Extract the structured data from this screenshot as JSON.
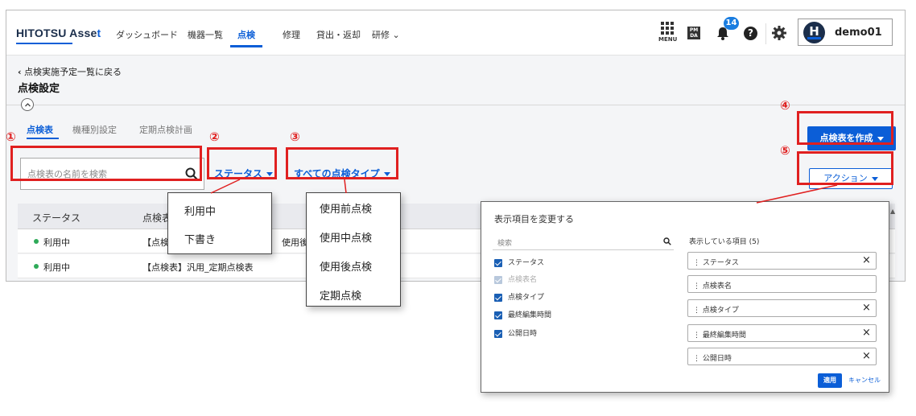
{
  "header": {
    "logo_main": "HITOTSU Asse",
    "logo_accent": "t",
    "nav": [
      "ダッシュボード",
      "機器一覧",
      "点検",
      "修理",
      "貸出・返却",
      "研修"
    ],
    "menu_label": "MENU",
    "pmda_label": "PM DA",
    "notification_count": "14",
    "help_label": "?",
    "user_initial": "H",
    "username": "demo01"
  },
  "page": {
    "back_link": "点検実施予定一覧に戻る",
    "title": "点検設定",
    "tabs": [
      "点検表",
      "機種別設定",
      "定期点検計画"
    ]
  },
  "toolbar": {
    "search_placeholder": "点検表の名前を検索",
    "status_dropdown": "ステータス",
    "type_dropdown": "すべての点検タイプ",
    "create_button": "点検表を作成",
    "action_button": "アクション"
  },
  "table": {
    "headers": [
      "ステータス",
      "点検表名"
    ],
    "rows": [
      {
        "status": "利用中",
        "name": "【点検表】",
        "extra": "使用後点"
      },
      {
        "status": "利用中",
        "name": "【点検表】汎用_定期点検表"
      }
    ]
  },
  "status_menu": [
    "利用中",
    "下書き"
  ],
  "type_menu": [
    "使用前点検",
    "使用中点検",
    "使用後点検",
    "定期点検"
  ],
  "column_panel": {
    "title": "表示項目を変更する",
    "search_placeholder": "検索",
    "options": [
      {
        "label": "ステータス",
        "disabled": false
      },
      {
        "label": "点検表名",
        "disabled": true
      },
      {
        "label": "点検タイプ",
        "disabled": false
      },
      {
        "label": "最終編集時間",
        "disabled": false
      },
      {
        "label": "公開日時",
        "disabled": false
      }
    ],
    "shown_title": "表示している項目 (5)",
    "shown_items": [
      "ステータス",
      "点検表名",
      "点検タイプ",
      "最終編集時間",
      "公開日時"
    ],
    "apply_button": "適用",
    "cancel_link": "キャンセル"
  },
  "annotations": [
    "①",
    "②",
    "③",
    "④",
    "⑤"
  ],
  "colors": {
    "primary": "#0b5ed7",
    "highlight": "#e02020",
    "active_status": "#2eaa58"
  }
}
